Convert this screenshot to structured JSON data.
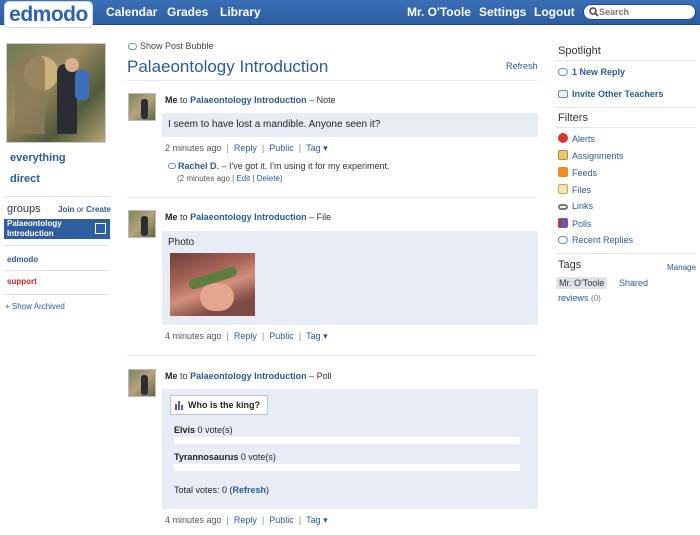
{
  "topbar": {
    "logo": "edmodo",
    "nav_left": [
      "Calendar",
      "Grades",
      "Library"
    ],
    "user": "Mr. O'Toole",
    "settings": "Settings",
    "logout": "Logout",
    "search_placeholder": "Search"
  },
  "left": {
    "everything": "everything",
    "direct": "direct",
    "groups_label": "groups",
    "join": "Join",
    "or": "or",
    "create": "Create",
    "selected_group": "Palaeontology Introduction",
    "groups": [
      "edmodo",
      "support"
    ],
    "show_archived": "+ Show Archived"
  },
  "main": {
    "show_bubble": "Show Post Bubble",
    "title": "Palaeontology Introduction",
    "refresh": "Refresh",
    "posts": [
      {
        "author": "Me",
        "to": "to",
        "group": "Palaeontology Introduction",
        "type": "– Note",
        "text": "I seem to have lost a mandible. Anyone seen it?",
        "time": "2 minutes ago",
        "reply": "Reply",
        "public": "Public",
        "tag": "Tag ▾",
        "replies": [
          {
            "author": "Rachel D.",
            "text": "– I've got it. I'm using it for my experiment.",
            "time": "(2 minutes ago",
            "edit": "Edit",
            "delete": "Delete)"
          }
        ]
      },
      {
        "author": "Me",
        "to": "to",
        "group": "Palaeontology Introduction",
        "type": "– File",
        "text": "Photo",
        "time": "4 minutes ago",
        "reply": "Reply",
        "public": "Public",
        "tag": "Tag ▾"
      },
      {
        "author": "Me",
        "to": "to",
        "group": "Palaeontology Introduction",
        "type": "– Poll",
        "question": "Who is the king?",
        "options": [
          {
            "label": "Elvis",
            "votes": "0 vote(s)"
          },
          {
            "label": "Tyrannosaurus",
            "votes": "0 vote(s)"
          }
        ],
        "total_label": "Total votes: 0 (",
        "total_refresh": "Refresh",
        "total_close": ")",
        "time": "4 minutes ago",
        "reply": "Reply",
        "public": "Public",
        "tag": "Tag ▾"
      }
    ]
  },
  "right": {
    "spotlight": "Spotlight",
    "new_reply": "1 New Reply",
    "invite": "Invite Other Teachers",
    "filters_heading": "Filters",
    "filters": [
      "Alerts",
      "Assignments",
      "Feeds",
      "Files",
      "Links",
      "Polls",
      "Recent Replies"
    ],
    "tags_heading": "Tags",
    "manage": "Manage",
    "tags": [
      {
        "label": "Mr. O'Toole"
      },
      {
        "label": "Shared"
      },
      {
        "label": "reviews",
        "count": "(0)"
      }
    ]
  },
  "colors": {
    "topbar": "#2d5da0",
    "link": "#2a5a9a",
    "post_bg": "#e8edf5",
    "selected_group": "#2e5e9e"
  }
}
